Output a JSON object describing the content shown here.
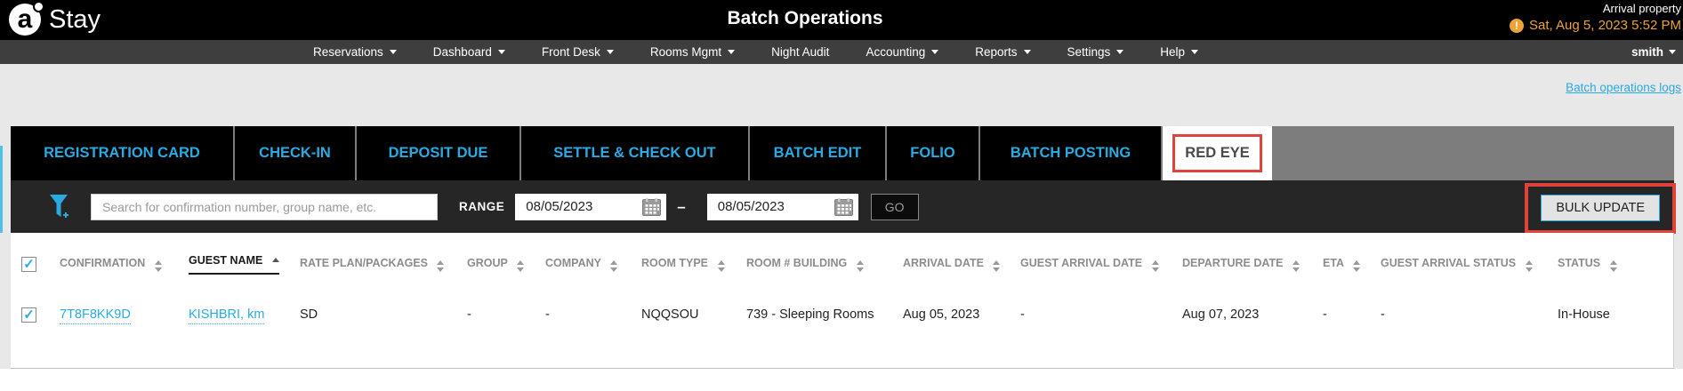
{
  "colors": {
    "accent": "#29ABE2",
    "warning": "#EDA338",
    "annotation_red": "#E0433C"
  },
  "header": {
    "logo_letter": "a",
    "logo_text": "Stay",
    "title": "Batch Operations",
    "property_label": "Arrival property",
    "datetime": "Sat, Aug 5, 2023 5:52 PM",
    "warning_glyph": "!"
  },
  "nav": {
    "items": [
      {
        "label": "Reservations",
        "dropdown": true
      },
      {
        "label": "Dashboard",
        "dropdown": true
      },
      {
        "label": "Front Desk",
        "dropdown": true
      },
      {
        "label": "Rooms Mgmt",
        "dropdown": true
      },
      {
        "label": "Night Audit",
        "dropdown": false
      },
      {
        "label": "Accounting",
        "dropdown": true
      },
      {
        "label": "Reports",
        "dropdown": true
      },
      {
        "label": "Settings",
        "dropdown": true
      },
      {
        "label": "Help",
        "dropdown": true
      }
    ],
    "user": "smith"
  },
  "logs_link": "Batch operations logs",
  "tabs": [
    {
      "label": "REGISTRATION CARD",
      "active": false
    },
    {
      "label": "CHECK-IN",
      "active": false
    },
    {
      "label": "DEPOSIT DUE",
      "active": false
    },
    {
      "label": "SETTLE & CHECK OUT",
      "active": false
    },
    {
      "label": "BATCH EDIT",
      "active": false
    },
    {
      "label": "FOLIO",
      "active": false
    },
    {
      "label": "BATCH POSTING",
      "active": false
    },
    {
      "label": "RED EYE",
      "active": true
    }
  ],
  "filter_bar": {
    "search_placeholder": "Search for confirmation number, group name, etc.",
    "range_label": "RANGE",
    "date_from": "08/05/2023",
    "date_to": "08/05/2023",
    "range_separator": "–",
    "go_label": "GO",
    "bulk_update_label": "BULK UPDATE"
  },
  "table": {
    "columns": [
      {
        "label": "CONFIRMATION",
        "sort": "both"
      },
      {
        "label": "GUEST NAME",
        "sort": "asc"
      },
      {
        "label": "RATE PLAN/PACKAGES",
        "sort": "both"
      },
      {
        "label": "GROUP",
        "sort": "both"
      },
      {
        "label": "COMPANY",
        "sort": "both"
      },
      {
        "label": "ROOM TYPE",
        "sort": "both"
      },
      {
        "label": "ROOM # BUILDING",
        "sort": "both"
      },
      {
        "label": "ARRIVAL DATE",
        "sort": "both"
      },
      {
        "label": "GUEST ARRIVAL DATE",
        "sort": "both"
      },
      {
        "label": "DEPARTURE DATE",
        "sort": "both"
      },
      {
        "label": "ETA",
        "sort": "both"
      },
      {
        "label": "GUEST ARRIVAL STATUS",
        "sort": "both"
      },
      {
        "label": "STATUS",
        "sort": "both"
      }
    ],
    "rows": [
      {
        "selected": true,
        "confirmation": "7T8F8KK9D",
        "guest_name": "KISHBRI, km",
        "rate_plan": "SD",
        "group": "-",
        "company": "-",
        "room_type": "NQQSOU",
        "room_building": "739 - Sleeping Rooms",
        "arrival_date": "Aug 05, 2023",
        "guest_arrival_date": "-",
        "departure_date": "Aug 07, 2023",
        "eta": "-",
        "guest_arrival_status": "-",
        "status": "In-House"
      }
    ]
  }
}
